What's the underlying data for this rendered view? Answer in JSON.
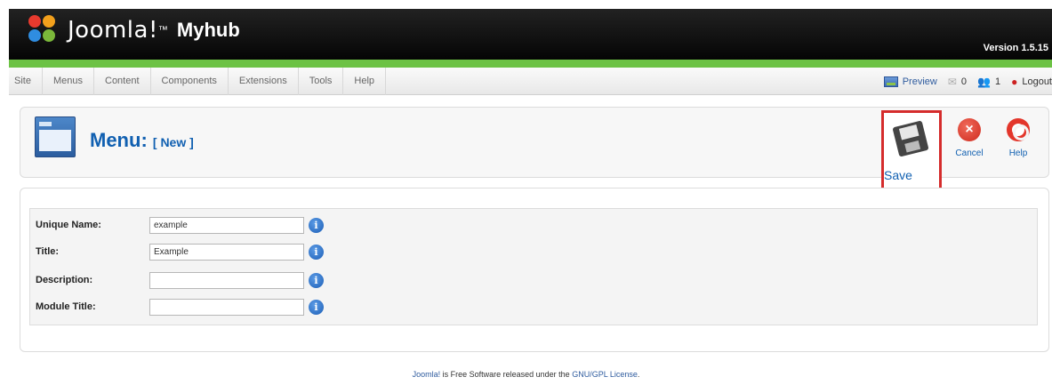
{
  "header": {
    "logo_text": "Joomla!",
    "site_name": "Myhub",
    "version": "Version 1.5.15"
  },
  "menubar": {
    "items": [
      {
        "label": "Site"
      },
      {
        "label": "Menus"
      },
      {
        "label": "Content"
      },
      {
        "label": "Components"
      },
      {
        "label": "Extensions"
      },
      {
        "label": "Tools"
      },
      {
        "label": "Help"
      }
    ],
    "preview": "Preview",
    "messages_count": "0",
    "users_count": "1",
    "logout": "Logout"
  },
  "toolbar": {
    "title": "Menu:",
    "subtitle": "[ New ]",
    "save_label": "Save",
    "cancel_label": "Cancel",
    "help_label": "Help"
  },
  "form": {
    "fields": [
      {
        "label": "Unique Name:",
        "value": ""
      },
      {
        "label": "Title:",
        "value": ""
      },
      {
        "label": "Description:",
        "value": ""
      },
      {
        "label": "Module Title:",
        "value": ""
      }
    ],
    "unique_name_value": "example",
    "title_value": "Example",
    "description_value": "",
    "module_title_value": ""
  },
  "footer": {
    "brand": "Joomla!",
    "middle": " is Free Software released under the ",
    "license": "GNU/GPL License",
    "end": "."
  },
  "colors": {
    "accent_blue": "#1160b1",
    "header_green": "#6cc244",
    "highlight_red": "#d52c2c"
  }
}
